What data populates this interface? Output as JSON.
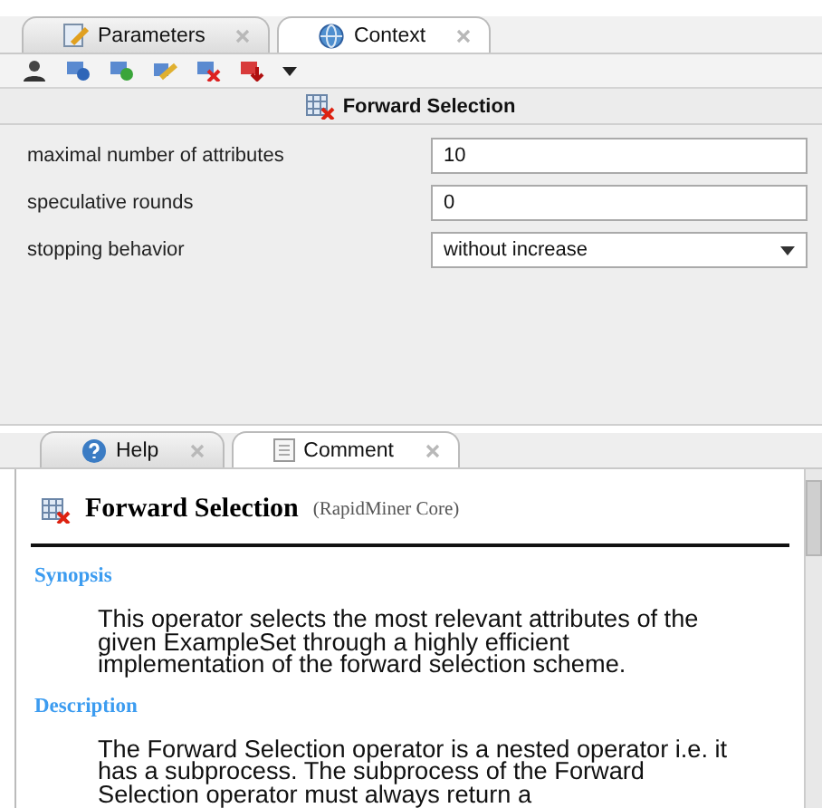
{
  "top_tabs": [
    {
      "label": "Parameters",
      "selected": false
    },
    {
      "label": "Context",
      "selected": true
    }
  ],
  "operator_title": "Forward Selection",
  "parameters": [
    {
      "kind": "text",
      "label": "maximal number of attributes",
      "value": "10"
    },
    {
      "kind": "text",
      "label": "speculative rounds",
      "value": "0"
    },
    {
      "kind": "select",
      "label": "stopping behavior",
      "value": "without increase"
    }
  ],
  "help_tabs": [
    {
      "label": "Help",
      "selected": false
    },
    {
      "label": "Comment",
      "selected": true
    }
  ],
  "help": {
    "title": "Forward Selection",
    "source": "(RapidMiner Core)",
    "sections": [
      {
        "heading": "Synopsis",
        "text": "This operator selects the most relevant attributes of the given ExampleSet through a highly efficient implementation of the forward selection scheme."
      },
      {
        "heading": "Description",
        "text": "The Forward Selection operator is a nested operator i.e. it has a subprocess. The subprocess of the Forward Selection operator must always return a"
      }
    ]
  }
}
